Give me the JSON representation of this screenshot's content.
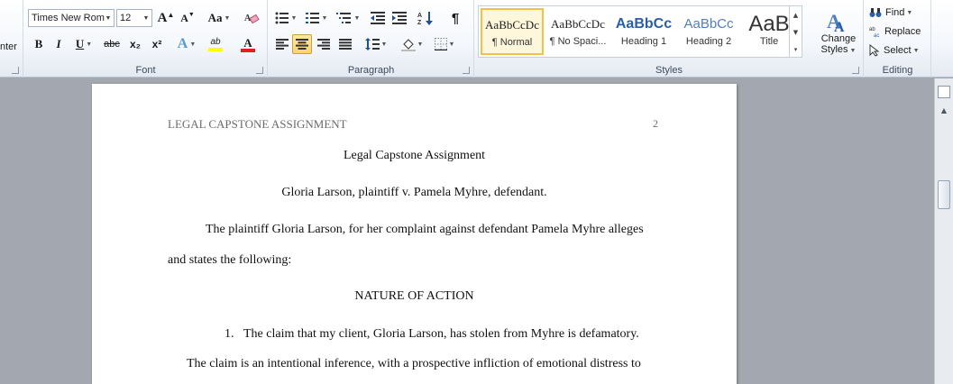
{
  "ribbon": {
    "clipboard_partial": "nter",
    "font": {
      "group_label": "Font",
      "font_name": "Times New Rom",
      "font_size": "12",
      "grow_font": "A",
      "shrink_font": "A",
      "change_case": "Aa",
      "bold": "B",
      "italic": "I",
      "underline": "U",
      "strikethrough": "abc",
      "subscript": "x₂",
      "superscript": "x²",
      "text_effects": "A",
      "highlight": "ab",
      "font_color": "A",
      "highlight_color": "#ffff00",
      "font_color_value": "#e02020"
    },
    "paragraph": {
      "group_label": "Paragraph",
      "pilcrow": "¶"
    },
    "styles": {
      "group_label": "Styles",
      "items": [
        {
          "preview": "AaBbCcDc",
          "name": "¶ Normal",
          "selected": true
        },
        {
          "preview": "AaBbCcDc",
          "name": "¶ No Spaci...",
          "selected": false
        },
        {
          "preview": "AaBbCc",
          "name": "Heading 1",
          "selected": false
        },
        {
          "preview": "AaBbCc",
          "name": "Heading 2",
          "selected": false
        },
        {
          "preview": "AaB",
          "name": "Title",
          "selected": false
        }
      ],
      "change_styles_line1": "Change",
      "change_styles_line2": "Styles"
    },
    "editing": {
      "group_label": "Editing",
      "find": "Find",
      "replace": "Replace",
      "select": "Select"
    }
  },
  "document": {
    "header_text": "LEGAL CAPSTONE ASSIGNMENT",
    "page_number": "2",
    "title": "Legal Capstone Assignment",
    "case_line": "Gloria Larson, plaintiff v. Pamela Myhre, defendant.",
    "para1_line1": "The plaintiff Gloria Larson, for her complaint against defendant Pamela Myhre alleges",
    "para1_line2": "and states the following:",
    "section_heading": "NATURE OF ACTION",
    "list_number": "1.",
    "list_item_1": "The claim that my client, Gloria Larson, has stolen from Myhre is defamatory.",
    "para2_line1": "The claim is an intentional inference, with a prospective infliction of emotional distress to"
  }
}
